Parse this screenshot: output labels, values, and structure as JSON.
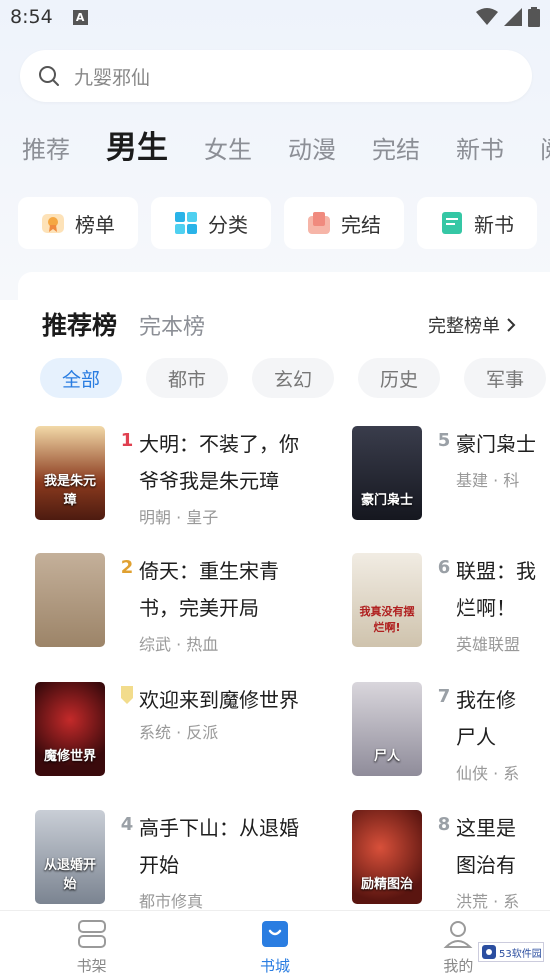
{
  "status_bar": {
    "time": "8:54",
    "notif_glyph": "A"
  },
  "search": {
    "placeholder": "九婴邪仙"
  },
  "channels": [
    "推荐",
    "男生",
    "女生",
    "动漫",
    "完结",
    "新书",
    "阅"
  ],
  "active_channel": "男生",
  "quick_links": [
    {
      "label": "榜单",
      "icon": "ranking-icon",
      "color": "#f5a742"
    },
    {
      "label": "分类",
      "icon": "category-icon",
      "color": "#29b3e8"
    },
    {
      "label": "完结",
      "icon": "completed-book-icon",
      "color": "#f08a7e"
    },
    {
      "label": "新书",
      "icon": "new-book-icon",
      "color": "#35c7a5"
    }
  ],
  "ranking": {
    "tabs": [
      "推荐榜",
      "完本榜"
    ],
    "full_list_label": "完整榜单",
    "chips": [
      "全部",
      "都市",
      "玄幻",
      "历史",
      "军事"
    ],
    "books": [
      {
        "rank": "1",
        "title_lines": [
          "大明：不装了，你",
          "爷爷我是朱元璋"
        ],
        "tags": "明朝 · 皇子",
        "cover_text": "我是朱元璋",
        "rank_color": "#e04050",
        "cover_color": "#8a3a1e"
      },
      {
        "rank": "2",
        "title_lines": [
          "倚天：重生宋青",
          "书，完美开局"
        ],
        "tags": "综武 · 热血",
        "cover_text": "",
        "rank_color": "#e0a030",
        "cover_color": "#b29a7c"
      },
      {
        "rank": "",
        "title_lines": [
          "欢迎来到魔修世界"
        ],
        "tags": "系统 · 反派",
        "cover_text": "魔修世界",
        "rank_color": "#e8c65a",
        "cover_color": "#6a1417"
      },
      {
        "rank": "4",
        "title_lines": [
          "高手下山：从退婚",
          "开始"
        ],
        "tags": "都市修真",
        "cover_text": "从退婚开始",
        "rank_color": "#9aa0a6",
        "cover_color": "#8c94a0"
      },
      {
        "rank": "5",
        "title_lines": [
          "豪门枭士"
        ],
        "tags": "基建 · 科",
        "cover_text": "豪门枭士",
        "rank_color": "#9aa0a6",
        "cover_color": "#1f2230"
      },
      {
        "rank": "6",
        "title_lines": [
          "联盟：我",
          "烂啊！"
        ],
        "tags": "英雄联盟",
        "cover_text": "我真没有摆烂啊!",
        "rank_color": "#9aa0a6",
        "cover_color": "#d9d2c4"
      },
      {
        "rank": "7",
        "title_lines": [
          "我在修",
          "尸人"
        ],
        "tags": "仙侠 · 系",
        "cover_text": "尸人",
        "rank_color": "#9aa0a6",
        "cover_color": "#a5a3b0"
      },
      {
        "rank": "8",
        "title_lines": [
          "这里是",
          "图治有"
        ],
        "tags": "洪荒 · 系",
        "cover_text": "励精图治",
        "rank_color": "#9aa0a6",
        "cover_color": "#9b2a22"
      }
    ]
  },
  "bottom_nav": [
    {
      "label": "书架",
      "icon": "bookshelf-icon"
    },
    {
      "label": "书城",
      "icon": "bookstore-icon"
    },
    {
      "label": "我的",
      "icon": "profile-icon"
    }
  ],
  "active_nav": "书城",
  "watermark": {
    "text": "53软件园"
  }
}
